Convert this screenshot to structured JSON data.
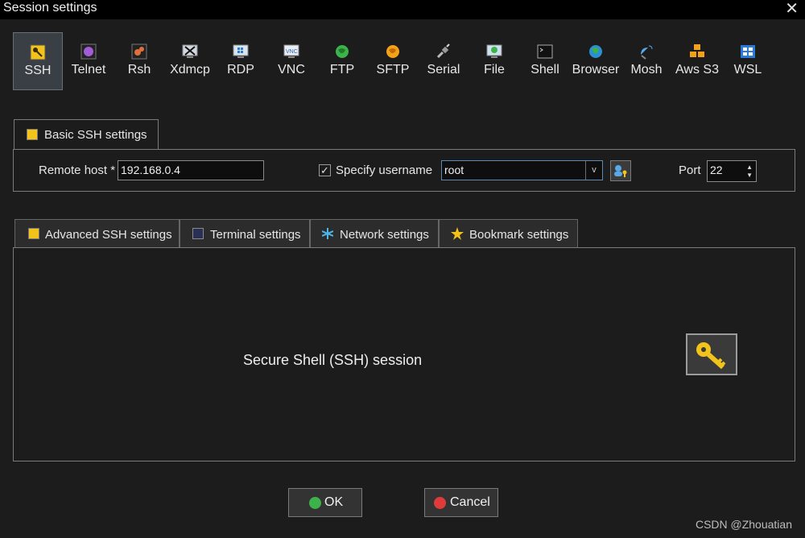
{
  "window": {
    "title": "Session settings",
    "close_glyph": "✕"
  },
  "toolbar": {
    "items": [
      {
        "label": "SSH",
        "icon": "ssh-key-icon",
        "active": true
      },
      {
        "label": "Telnet",
        "icon": "telnet-icon",
        "active": false
      },
      {
        "label": "Rsh",
        "icon": "rsh-icon",
        "active": false
      },
      {
        "label": "Xdmcp",
        "icon": "xdmcp-icon",
        "active": false
      },
      {
        "label": "RDP",
        "icon": "rdp-icon",
        "active": false
      },
      {
        "label": "VNC",
        "icon": "vnc-icon",
        "active": false
      },
      {
        "label": "FTP",
        "icon": "ftp-globe-icon",
        "active": false
      },
      {
        "label": "SFTP",
        "icon": "sftp-globe-icon",
        "active": false
      },
      {
        "label": "Serial",
        "icon": "serial-plug-icon",
        "active": false
      },
      {
        "label": "File",
        "icon": "file-monitor-icon",
        "active": false
      },
      {
        "label": "Shell",
        "icon": "shell-terminal-icon",
        "active": false
      },
      {
        "label": "Browser",
        "icon": "browser-globe-icon",
        "active": false
      },
      {
        "label": "Mosh",
        "icon": "mosh-satellite-icon",
        "active": false
      },
      {
        "label": "Aws S3",
        "icon": "aws-s3-cubes-icon",
        "active": false
      },
      {
        "label": "WSL",
        "icon": "wsl-windows-icon",
        "active": false
      }
    ]
  },
  "basic": {
    "tab_label": "Basic SSH settings",
    "remote_host_label": "Remote host *",
    "remote_host_value": "192.168.0.4",
    "specify_username_label": "Specify username",
    "specify_username_checked": true,
    "checkbox_glyph": "✓",
    "username_value": "root",
    "dropdown_glyph": "v",
    "port_label": "Port",
    "port_value": "22",
    "spin_up": "▲",
    "spin_down": "▼"
  },
  "advanced_tabs": [
    {
      "label": "Advanced SSH settings",
      "icon": "wrench-icon"
    },
    {
      "label": "Terminal settings",
      "icon": "terminal-icon"
    },
    {
      "label": "Network settings",
      "icon": "network-star-icon"
    },
    {
      "label": "Bookmark settings",
      "icon": "star-icon"
    }
  ],
  "main": {
    "description": "Secure Shell (SSH) session"
  },
  "buttons": {
    "ok_label": "OK",
    "cancel_label": "Cancel"
  },
  "watermark": "CSDN @Zhouatian",
  "colors": {
    "background": "#1c1c1c",
    "accent_key": "#f2c31a",
    "ok_green": "#3db24a",
    "cancel_red": "#e03b3b"
  }
}
